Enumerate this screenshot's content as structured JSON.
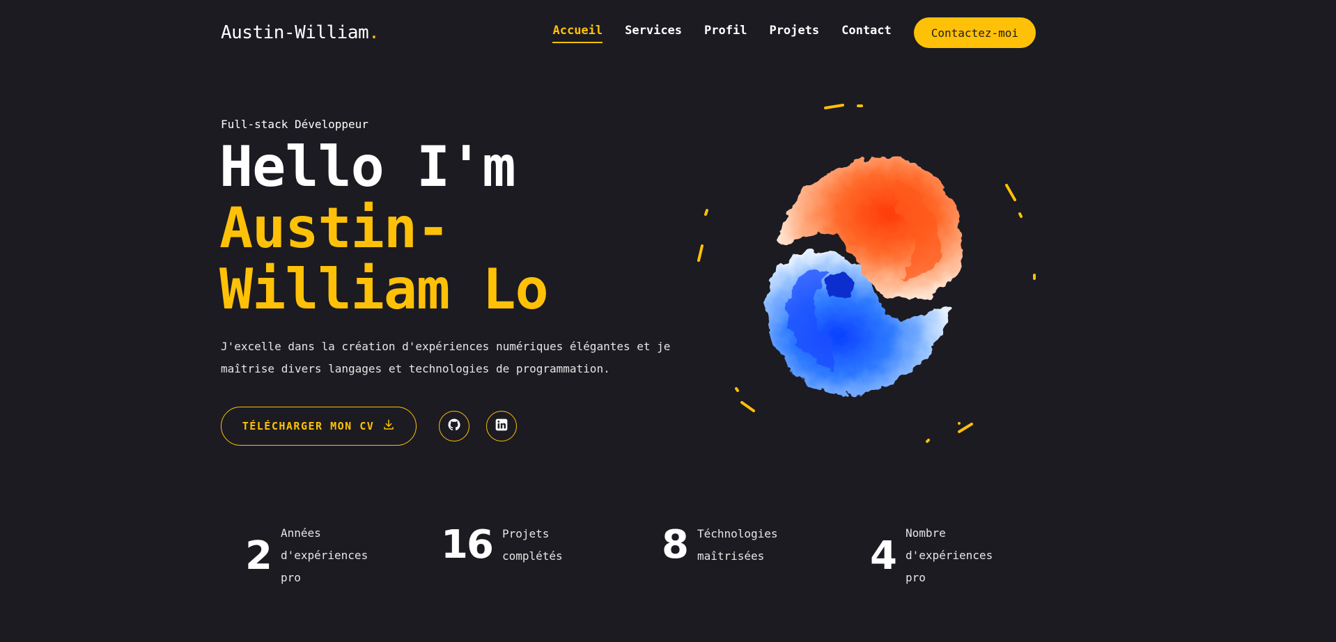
{
  "header": {
    "logo_text": "Austin-William",
    "logo_dot": ".",
    "nav": [
      {
        "label": "Accueil",
        "active": true
      },
      {
        "label": "Services"
      },
      {
        "label": "Profil"
      },
      {
        "label": "Projets"
      },
      {
        "label": "Contact"
      }
    ],
    "cta_label": "Contactez-moi"
  },
  "hero": {
    "subtitle": "Full-stack Développeur",
    "hello": "Hello I'm",
    "name": "Austin-William Lo",
    "description": "J'excelle dans la création d'expériences numériques élégantes et je maîtrise divers langages et technologies de programmation.",
    "cv_button": "TÉLÉCHARGER MON CV",
    "cv_icon": "download-icon",
    "socials": [
      {
        "icon": "github-icon"
      },
      {
        "icon": "linkedin-icon"
      }
    ]
  },
  "stats": [
    {
      "value": "2",
      "label": "Années d'expériences pro"
    },
    {
      "value": "16",
      "label": "Projets complétés"
    },
    {
      "value": "8",
      "label": "Téchnologies maîtrisées"
    },
    {
      "value": "4",
      "label": "Nombre d'expériences pro"
    }
  ],
  "colors": {
    "background": "#1c1b22",
    "accent": "#ffc107",
    "text": "#ffffff",
    "fire": "#ff5a1f",
    "ice": "#2f7bff"
  }
}
